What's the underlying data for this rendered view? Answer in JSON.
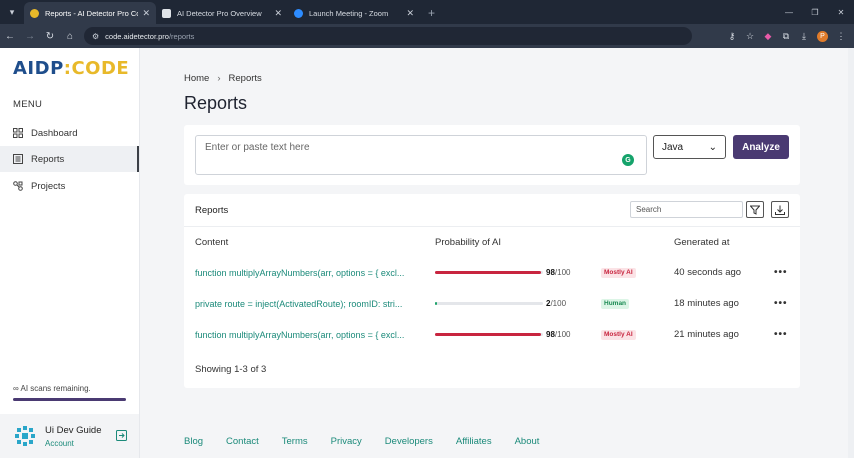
{
  "browser": {
    "tabs": [
      {
        "title": "Reports - AI Detector Pro Code",
        "active": true,
        "favicon_color": "#e8b92a"
      },
      {
        "title": "AI Detector Pro Overview",
        "active": false,
        "favicon_color": "#dfe3e8"
      },
      {
        "title": "Launch Meeting - Zoom",
        "active": false,
        "favicon_color": "#2d8cff"
      }
    ],
    "new_tab": "+",
    "url_host": "code.aidetector.pro",
    "url_path": "/reports",
    "profile_initial": "P"
  },
  "sidebar": {
    "logo_part1": "AIDP",
    "logo_part2": ":CODE",
    "menu_label": "MENU",
    "items": [
      {
        "label": "Dashboard",
        "icon": "dashboard-icon",
        "active": false
      },
      {
        "label": "Reports",
        "icon": "reports-icon",
        "active": true
      },
      {
        "label": "Projects",
        "icon": "projects-icon",
        "active": false
      }
    ],
    "scans_text": "∞ AI scans remaining.",
    "user_name": "Ui Dev Guide",
    "user_account": "Account"
  },
  "main": {
    "breadcrumb_home": "Home",
    "breadcrumb_current": "Reports",
    "page_title": "Reports",
    "input_placeholder": "Enter or paste text here",
    "language_selected": "Java",
    "analyze_label": "Analyze",
    "reports_title": "Reports",
    "search_placeholder": "Search",
    "columns": [
      "Content",
      "Probability of AI",
      "Generated at"
    ],
    "rows": [
      {
        "content": "function multiplyArrayNumbers(arr, options = { excl...",
        "score": "98",
        "of": "/100",
        "probability": 0.98,
        "badge": "Mostly AI",
        "badge_kind": "ai",
        "generated": "40 seconds ago"
      },
      {
        "content": "private route = inject(ActivatedRoute); roomID: stri...",
        "score": "2",
        "of": "/100",
        "probability": 0.02,
        "badge": "Human",
        "badge_kind": "human",
        "generated": "18 minutes ago"
      },
      {
        "content": "function multiplyArrayNumbers(arr, options = { excl...",
        "score": "98",
        "of": "/100",
        "probability": 0.98,
        "badge": "Mostly AI",
        "badge_kind": "ai",
        "generated": "21 minutes ago"
      }
    ],
    "row_menu": "•••",
    "showing": "Showing 1-3 of 3"
  },
  "footer": {
    "links": [
      "Blog",
      "Contact",
      "Terms",
      "Privacy",
      "Developers",
      "Affiliates",
      "About"
    ]
  },
  "colors": {
    "accent": "#4a3a72",
    "link": "#1b8a7a",
    "ai_bar": "#c8253f",
    "human_bar": "#1ea36b"
  }
}
